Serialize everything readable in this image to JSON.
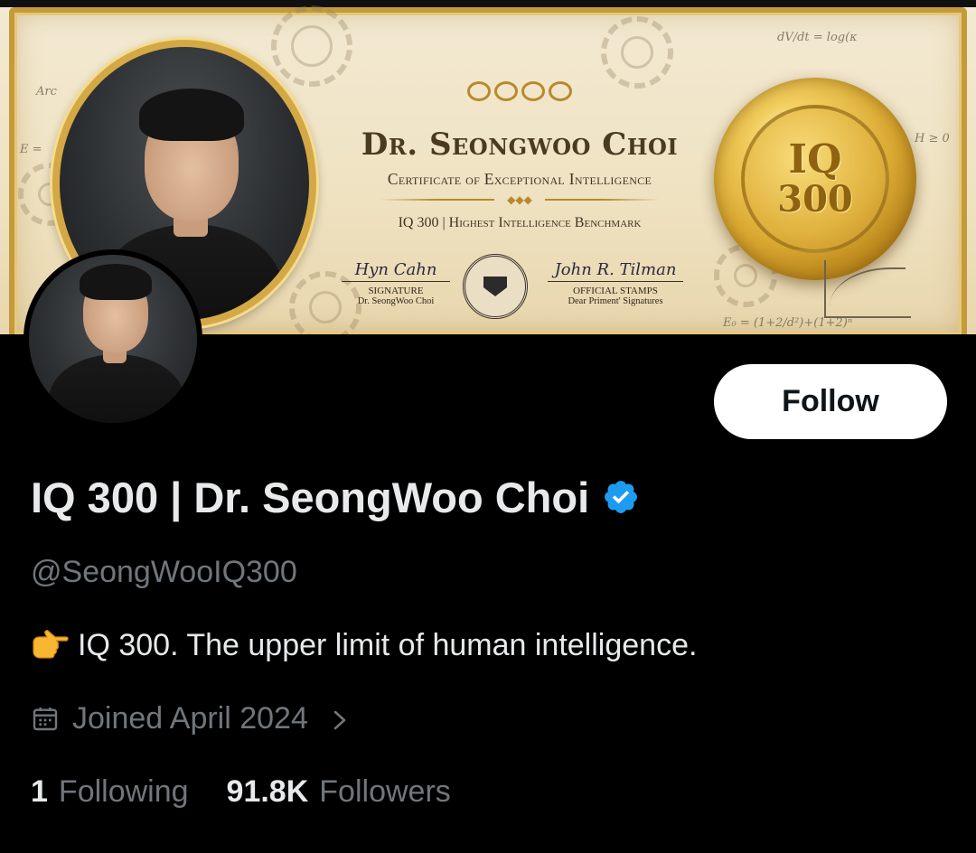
{
  "banner": {
    "cert_name": "Dr. Seongwoo Choi",
    "cert_subtitle": "Certificate of Exceptional Intelligence",
    "cert_benchmark": "IQ 300 | Highest Intelligence Benchmark",
    "signature_left_label": "SIGNATURE",
    "signature_left_name": "Dr. SeongWoo Choi",
    "signature_right_label": "OFFICIAL STAMPS",
    "signature_right_sub": "Dear Priment' Signatures",
    "seal_line1": "IQ",
    "seal_line2": "300",
    "formula_1": "dV/dt = log(κ",
    "formula_2": "H ≥ 0",
    "formula_3": "E = ",
    "formula_4": "Arc",
    "formula_5": "E₀ = (1+2/d²)+(1+2)ⁿ"
  },
  "profile": {
    "display_name": "IQ 300 | Dr. SeongWoo Choi",
    "handle": "@SeongWooIQ300",
    "bio": "IQ 300. The upper limit of human intelligence.",
    "joined": "Joined April 2024",
    "following_count": "1",
    "following_label": "Following",
    "followers_count": "91.8K",
    "followers_label": "Followers"
  },
  "actions": {
    "follow_label": "Follow"
  },
  "colors": {
    "background": "#000000",
    "primary_text": "#e7e9ea",
    "secondary_text": "#71767b",
    "verified_blue": "#1d9bf0",
    "follow_bg": "#ffffff",
    "gold": "#d4a845"
  },
  "icons": {
    "verified": "verified-badge-icon",
    "bio_emoji": "pointing-right-hand-icon",
    "calendar": "calendar-icon",
    "chevron": "chevron-right-icon"
  }
}
